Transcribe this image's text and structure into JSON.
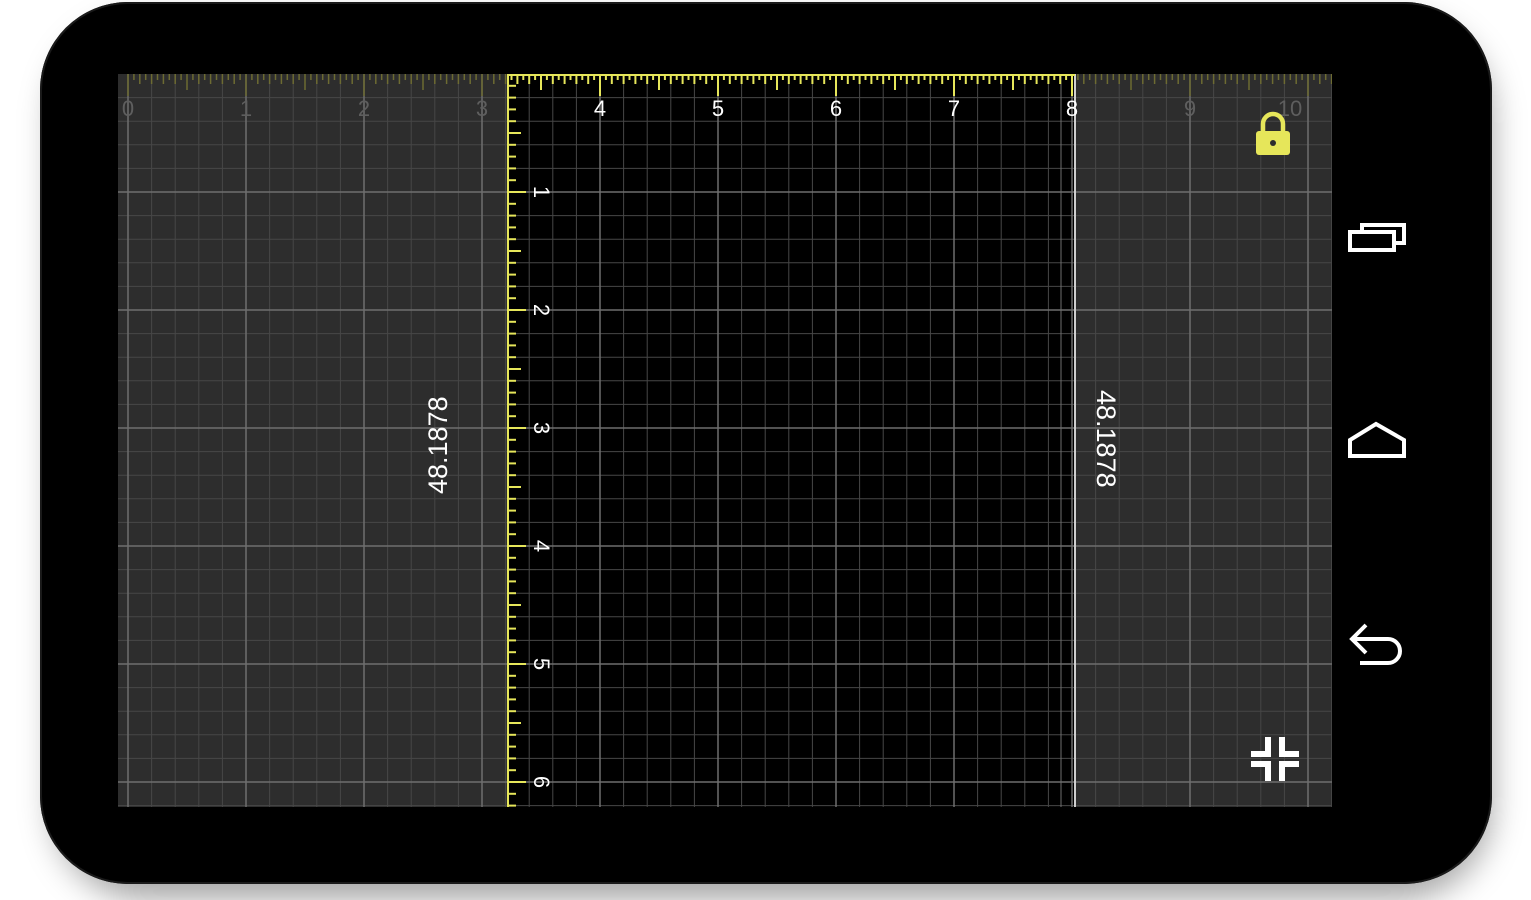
{
  "ruler": {
    "x_ticks": [
      "0",
      "1",
      "2",
      "3",
      "4",
      "5",
      "6",
      "7",
      "8",
      "9",
      "10"
    ],
    "y_ticks": [
      "1",
      "2",
      "3",
      "4",
      "5",
      "6"
    ],
    "measure_left": "48.1878",
    "measure_right": "48.1878"
  },
  "colors": {
    "accent": "#e6e65a",
    "grid_major": "#6e6e6e",
    "grid_minor": "#474747",
    "panel_bg": "#2d2d2d",
    "selection_bg": "#000000"
  },
  "icons": {
    "lock": "lock-icon",
    "collapse": "collapse-icon",
    "recents": "recents-icon",
    "home": "home-icon",
    "back": "back-icon"
  }
}
